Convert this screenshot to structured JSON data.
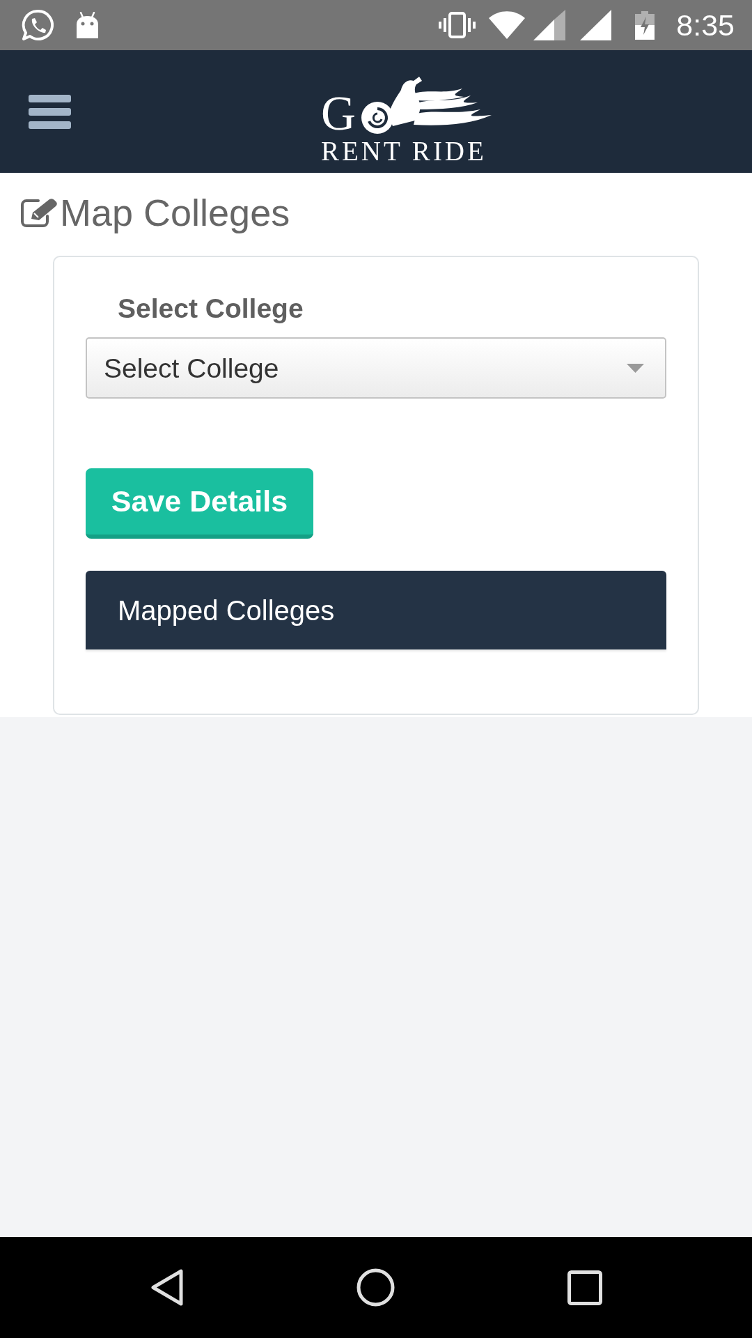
{
  "status_bar": {
    "time": "8:35"
  },
  "header": {
    "logo": {
      "letter": "G",
      "tagline": "RENT RIDE"
    }
  },
  "page": {
    "title": "Map Colleges"
  },
  "form": {
    "college_field": {
      "label": "Select College",
      "placeholder": "Select College"
    },
    "save_button": {
      "label": "Save Details"
    }
  },
  "mapped_colleges": {
    "title": "Mapped Colleges"
  }
}
